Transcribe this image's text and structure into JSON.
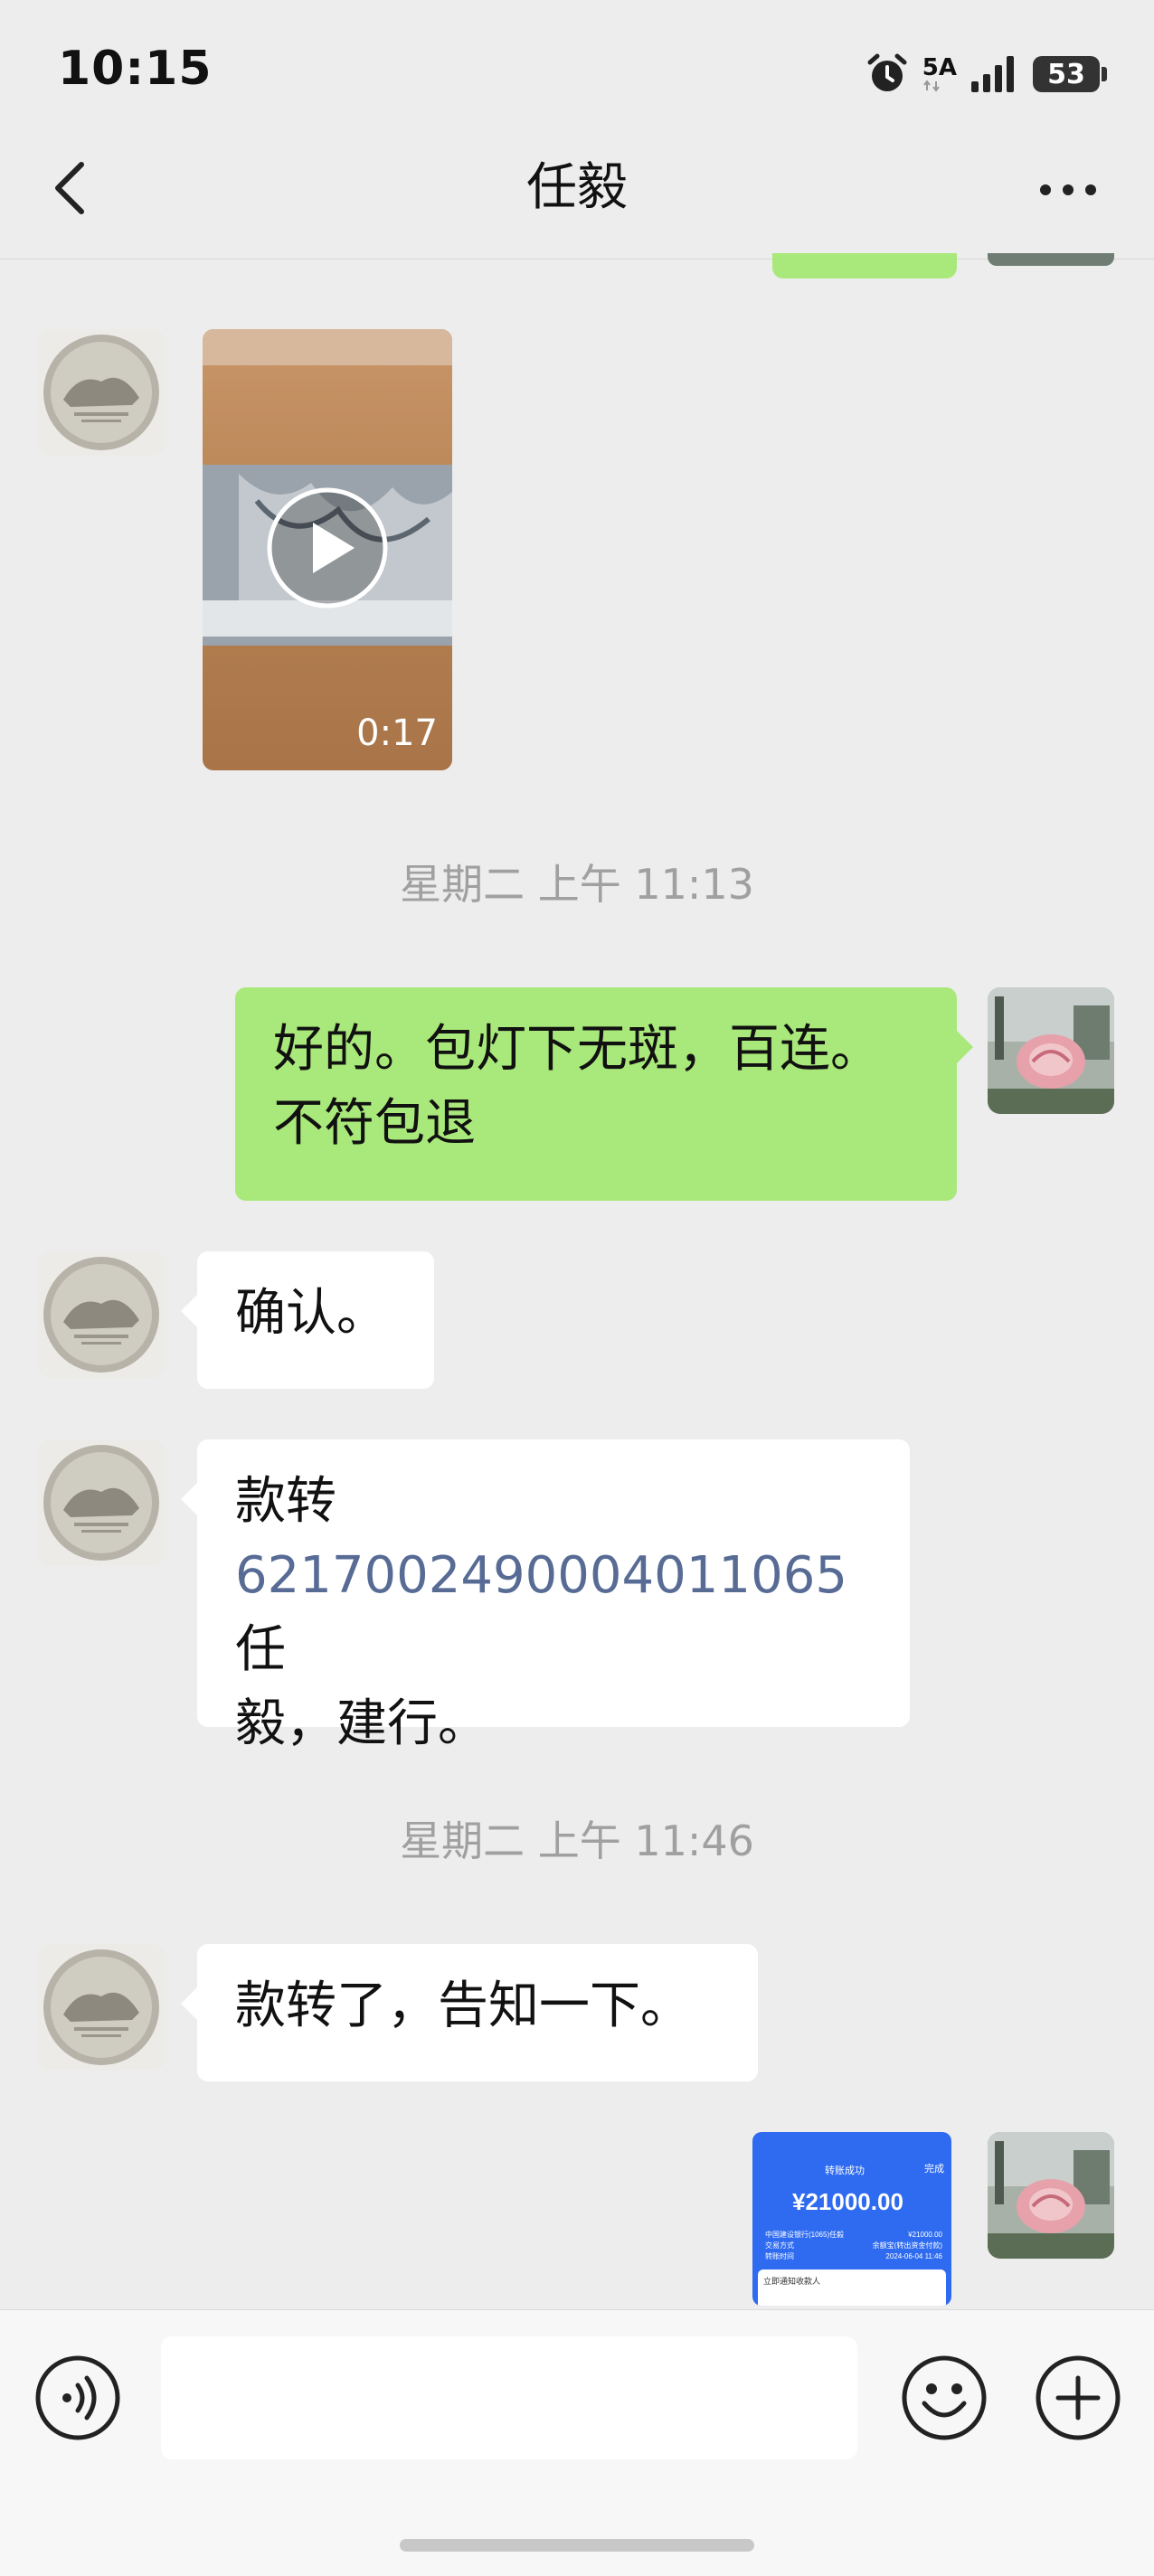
{
  "status_bar": {
    "time": "10:15",
    "network": "5A",
    "battery": "53",
    "icons": [
      "alarm-icon",
      "signal-icon",
      "battery-icon"
    ]
  },
  "header": {
    "title": "任毅",
    "back_icon": "chevron-left-icon",
    "more_icon": "more-dots-icon"
  },
  "messages": {
    "video": {
      "duration": "0:17",
      "play_icon": "play-icon"
    },
    "timestamp_1": "星期二 上午 11:13",
    "sent_1": {
      "line1": "好的。包灯下无斑，百连。",
      "line2": "不符包退"
    },
    "received_1": "确认。",
    "received_2": {
      "prefix": "款转",
      "account_number": "6217002490004011065",
      "suffix_line2_start": "任",
      "line3": "毅，建行。"
    },
    "timestamp_2": "星期二 上午 11:46",
    "received_3": "款转了，告知一下。",
    "screenshot_thumb": {
      "status_text": "转账成功",
      "done_label": "完成",
      "amount": "¥21000.00",
      "row1_left": "中国建设银行(1065)任毅",
      "row1_right": "¥21000.00",
      "row2_left": "交易方式",
      "row2_right": "余额宝(转出资金付款)",
      "row3_left": "转账时间",
      "row3_right": "2024-06-04 11:46",
      "notify_label": "立即通知收款人"
    }
  },
  "input_bar": {
    "voice_icon": "voice-icon",
    "placeholder": "",
    "emoji_icon": "emoji-icon",
    "add_icon": "plus-icon"
  },
  "colors": {
    "background": "#ededed",
    "sent_bubble": "#a9e87a",
    "received_bubble": "#ffffff",
    "link": "#576b95",
    "timestamp": "#a0a0a0",
    "transfer_blue": "#2e6bf0"
  }
}
